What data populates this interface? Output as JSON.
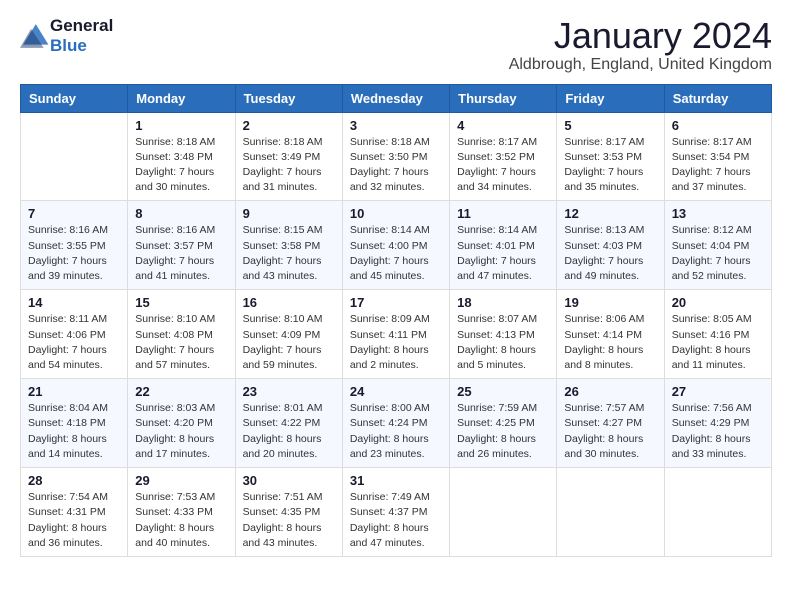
{
  "logo": {
    "line1": "General",
    "line2": "Blue"
  },
  "title": "January 2024",
  "location": "Aldbrough, England, United Kingdom",
  "days_of_week": [
    "Sunday",
    "Monday",
    "Tuesday",
    "Wednesday",
    "Thursday",
    "Friday",
    "Saturday"
  ],
  "weeks": [
    [
      {
        "day": "",
        "info": ""
      },
      {
        "day": "1",
        "info": "Sunrise: 8:18 AM\nSunset: 3:48 PM\nDaylight: 7 hours\nand 30 minutes."
      },
      {
        "day": "2",
        "info": "Sunrise: 8:18 AM\nSunset: 3:49 PM\nDaylight: 7 hours\nand 31 minutes."
      },
      {
        "day": "3",
        "info": "Sunrise: 8:18 AM\nSunset: 3:50 PM\nDaylight: 7 hours\nand 32 minutes."
      },
      {
        "day": "4",
        "info": "Sunrise: 8:17 AM\nSunset: 3:52 PM\nDaylight: 7 hours\nand 34 minutes."
      },
      {
        "day": "5",
        "info": "Sunrise: 8:17 AM\nSunset: 3:53 PM\nDaylight: 7 hours\nand 35 minutes."
      },
      {
        "day": "6",
        "info": "Sunrise: 8:17 AM\nSunset: 3:54 PM\nDaylight: 7 hours\nand 37 minutes."
      }
    ],
    [
      {
        "day": "7",
        "info": "Sunrise: 8:16 AM\nSunset: 3:55 PM\nDaylight: 7 hours\nand 39 minutes."
      },
      {
        "day": "8",
        "info": "Sunrise: 8:16 AM\nSunset: 3:57 PM\nDaylight: 7 hours\nand 41 minutes."
      },
      {
        "day": "9",
        "info": "Sunrise: 8:15 AM\nSunset: 3:58 PM\nDaylight: 7 hours\nand 43 minutes."
      },
      {
        "day": "10",
        "info": "Sunrise: 8:14 AM\nSunset: 4:00 PM\nDaylight: 7 hours\nand 45 minutes."
      },
      {
        "day": "11",
        "info": "Sunrise: 8:14 AM\nSunset: 4:01 PM\nDaylight: 7 hours\nand 47 minutes."
      },
      {
        "day": "12",
        "info": "Sunrise: 8:13 AM\nSunset: 4:03 PM\nDaylight: 7 hours\nand 49 minutes."
      },
      {
        "day": "13",
        "info": "Sunrise: 8:12 AM\nSunset: 4:04 PM\nDaylight: 7 hours\nand 52 minutes."
      }
    ],
    [
      {
        "day": "14",
        "info": "Sunrise: 8:11 AM\nSunset: 4:06 PM\nDaylight: 7 hours\nand 54 minutes."
      },
      {
        "day": "15",
        "info": "Sunrise: 8:10 AM\nSunset: 4:08 PM\nDaylight: 7 hours\nand 57 minutes."
      },
      {
        "day": "16",
        "info": "Sunrise: 8:10 AM\nSunset: 4:09 PM\nDaylight: 7 hours\nand 59 minutes."
      },
      {
        "day": "17",
        "info": "Sunrise: 8:09 AM\nSunset: 4:11 PM\nDaylight: 8 hours\nand 2 minutes."
      },
      {
        "day": "18",
        "info": "Sunrise: 8:07 AM\nSunset: 4:13 PM\nDaylight: 8 hours\nand 5 minutes."
      },
      {
        "day": "19",
        "info": "Sunrise: 8:06 AM\nSunset: 4:14 PM\nDaylight: 8 hours\nand 8 minutes."
      },
      {
        "day": "20",
        "info": "Sunrise: 8:05 AM\nSunset: 4:16 PM\nDaylight: 8 hours\nand 11 minutes."
      }
    ],
    [
      {
        "day": "21",
        "info": "Sunrise: 8:04 AM\nSunset: 4:18 PM\nDaylight: 8 hours\nand 14 minutes."
      },
      {
        "day": "22",
        "info": "Sunrise: 8:03 AM\nSunset: 4:20 PM\nDaylight: 8 hours\nand 17 minutes."
      },
      {
        "day": "23",
        "info": "Sunrise: 8:01 AM\nSunset: 4:22 PM\nDaylight: 8 hours\nand 20 minutes."
      },
      {
        "day": "24",
        "info": "Sunrise: 8:00 AM\nSunset: 4:24 PM\nDaylight: 8 hours\nand 23 minutes."
      },
      {
        "day": "25",
        "info": "Sunrise: 7:59 AM\nSunset: 4:25 PM\nDaylight: 8 hours\nand 26 minutes."
      },
      {
        "day": "26",
        "info": "Sunrise: 7:57 AM\nSunset: 4:27 PM\nDaylight: 8 hours\nand 30 minutes."
      },
      {
        "day": "27",
        "info": "Sunrise: 7:56 AM\nSunset: 4:29 PM\nDaylight: 8 hours\nand 33 minutes."
      }
    ],
    [
      {
        "day": "28",
        "info": "Sunrise: 7:54 AM\nSunset: 4:31 PM\nDaylight: 8 hours\nand 36 minutes."
      },
      {
        "day": "29",
        "info": "Sunrise: 7:53 AM\nSunset: 4:33 PM\nDaylight: 8 hours\nand 40 minutes."
      },
      {
        "day": "30",
        "info": "Sunrise: 7:51 AM\nSunset: 4:35 PM\nDaylight: 8 hours\nand 43 minutes."
      },
      {
        "day": "31",
        "info": "Sunrise: 7:49 AM\nSunset: 4:37 PM\nDaylight: 8 hours\nand 47 minutes."
      },
      {
        "day": "",
        "info": ""
      },
      {
        "day": "",
        "info": ""
      },
      {
        "day": "",
        "info": ""
      }
    ]
  ]
}
